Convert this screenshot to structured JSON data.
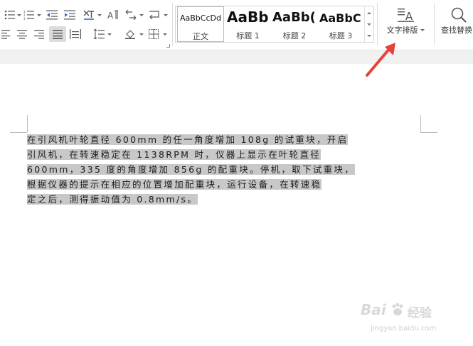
{
  "ribbon": {
    "styles": [
      {
        "sample": "AaBbCcDd",
        "label": "正文",
        "selected": true
      },
      {
        "sample": "AaBb",
        "label": "标题 1",
        "selected": false
      },
      {
        "sample": "AaBb(",
        "label": "标题 2",
        "selected": false
      },
      {
        "sample": "AaBbC",
        "label": "标题 3",
        "selected": false
      }
    ],
    "text_layout_label": "文字排版",
    "find_replace_label": "查找替换"
  },
  "document": {
    "lines": [
      "在引风机叶轮直径 600mm 的任一角度增加 108g 的试重块，开启",
      "引风机，在转速稳定在 1138RPM 时，仪器上显示在叶轮直径",
      "600mm，335 度的角度增加 856g 的配重块。停机，取下试重块，",
      "根据仪器的提示在相应的位置增加配重块，运行设备，在转速稳",
      "定之后，测得振动值为 0.8mm/s。"
    ]
  },
  "watermark": {
    "brand": "Bai",
    "brand_suffix": "经验",
    "url": "jingyan.baidu.com"
  },
  "colors": {
    "highlight": "#c8c8c8",
    "arrow": "#e8413b",
    "toolbar_bg": "#f1f1f1"
  }
}
